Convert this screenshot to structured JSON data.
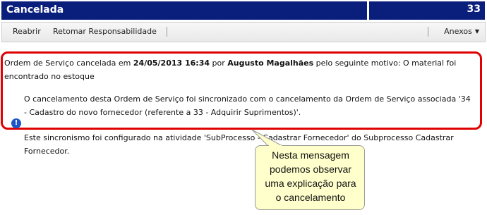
{
  "header": {
    "title": "Cancelada",
    "number": "33"
  },
  "toolbar": {
    "reabrir": "Reabrir",
    "retomar": "Retomar Responsabilidade",
    "anexos": "Anexos"
  },
  "message": {
    "line1_prefix": "Ordem de Serviço cancelada em ",
    "date": "24/05/2013 16:34",
    "by": " por ",
    "user": "Augusto Magalhães",
    "line1_suffix": " pelo seguinte motivo: O material foi",
    "line2": "encontrado no estoque",
    "sync_line1": "O cancelamento desta Ordem de Serviço foi sincronizado com o cancelamento da Ordem de Serviço associada '34",
    "sync_line2": "- Cadastro do novo fornecedor (referente a 33 - Adquirir Suprimentos)'.",
    "config_line1": "Este sincronismo foi configurado na atividade 'SubProcesso - Cadastrar Fornecedor' do Subprocesso Cadastrar",
    "config_line2": "Fornecedor."
  },
  "callout": {
    "line1": "Nesta mensagem",
    "line2": "podemos observar",
    "line3": "uma explicação para",
    "line4": "o cancelamento"
  },
  "colors": {
    "title_bar": "#0a1f7c",
    "highlight": "#e00000",
    "callout_bg": "#ffffcc",
    "info_icon": "#1d56c8"
  }
}
